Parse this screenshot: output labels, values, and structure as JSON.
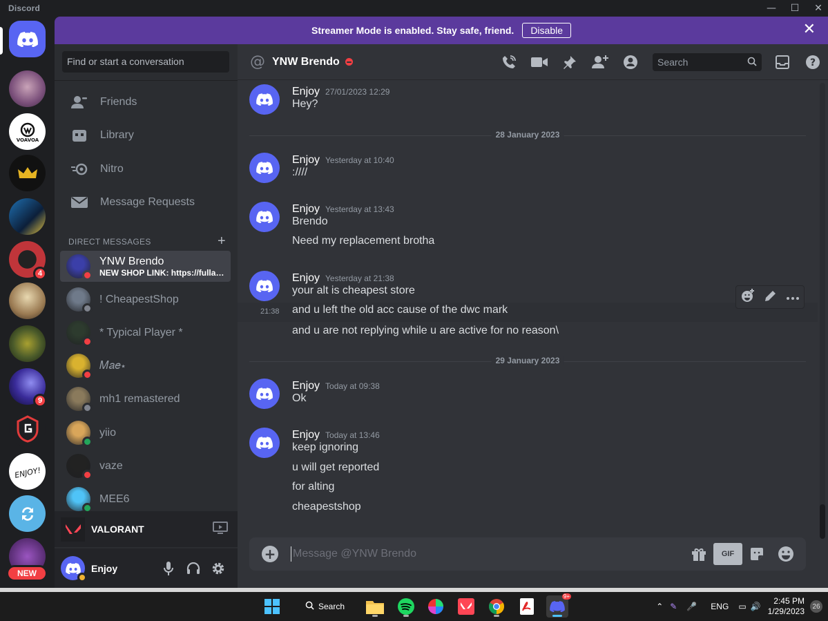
{
  "window": {
    "app_name": "Discord"
  },
  "banner": {
    "text": "Streamer Mode is enabled. Stay safe, friend.",
    "button": "Disable"
  },
  "rail": {
    "badges": {
      "server_5": "4",
      "server_9": "9"
    },
    "new_label": "NEW"
  },
  "sidebar": {
    "search_placeholder": "Find or start a conversation",
    "nav": [
      "Friends",
      "Library",
      "Nitro",
      "Message Requests"
    ],
    "dm_header": "Direct Messages",
    "conversations": [
      {
        "name": "YNW Brendo",
        "sub": "NEW SHOP LINK: https://fullaccess.store",
        "status": "dnd",
        "color": "#3b3fa8"
      },
      {
        "name": "! CheapestShop",
        "status": "offline",
        "color": "#6f7a8a"
      },
      {
        "name": "* Typical Player *",
        "status": "dnd",
        "color": "#2d3b2e"
      },
      {
        "name": "𝑀𝑎𝑒⋆",
        "status": "dnd",
        "color": "#d9b22f"
      },
      {
        "name": "mh1 remastered",
        "status": "offline",
        "color": "#8a7a5c"
      },
      {
        "name": "yiio",
        "status": "mobile",
        "color": "#d9a65a"
      },
      {
        "name": "vaze",
        "status": "dnd",
        "color": "#222222"
      },
      {
        "name": "MEE6",
        "status": "online",
        "color": "#4fc3f7"
      }
    ],
    "game": {
      "name": "VALORANT"
    },
    "user": {
      "name": "Enjoy"
    }
  },
  "chat": {
    "recipient": "YNW Brendo",
    "search_placeholder": "Search",
    "messages": [
      {
        "author": "Enjoy",
        "timestamp": "27/01/2023 12:29",
        "lines": [
          "Hey?"
        ]
      },
      {
        "divider": "28 January 2023"
      },
      {
        "author": "Enjoy",
        "timestamp": "Yesterday at 10:40",
        "lines": [
          ":////"
        ]
      },
      {
        "author": "Enjoy",
        "timestamp": "Yesterday at 13:43",
        "lines": [
          "Brendo",
          "Need my replacement brotha"
        ]
      },
      {
        "author": "Enjoy",
        "timestamp": "Yesterday at 21:38",
        "lines": [
          "your alt is cheapest store",
          "and u left the old acc cause of the dwc mark",
          "and u are not replying while u are active for no reason\\"
        ],
        "hover_time": "21:38"
      },
      {
        "divider": "29 January 2023"
      },
      {
        "author": "Enjoy",
        "timestamp": "Today at 09:38",
        "lines": [
          "Ok"
        ]
      },
      {
        "author": "Enjoy",
        "timestamp": "Today at 13:46",
        "lines": [
          "keep ignoring",
          "u will get reported",
          "for alting",
          "cheapestshop"
        ]
      }
    ],
    "composer_placeholder": "Message @YNW Brendo",
    "gif_label": "GIF"
  },
  "taskbar": {
    "search_label": "Search",
    "discord_badge": "9+",
    "language": "ENG",
    "time": "2:45 PM",
    "date": "1/29/2023",
    "notifications": "26"
  },
  "colors": {
    "accent": "#5865f2",
    "banner": "#5b3a9d",
    "dnd": "#f23f43",
    "online": "#23a55a",
    "idle": "#f0b232"
  }
}
